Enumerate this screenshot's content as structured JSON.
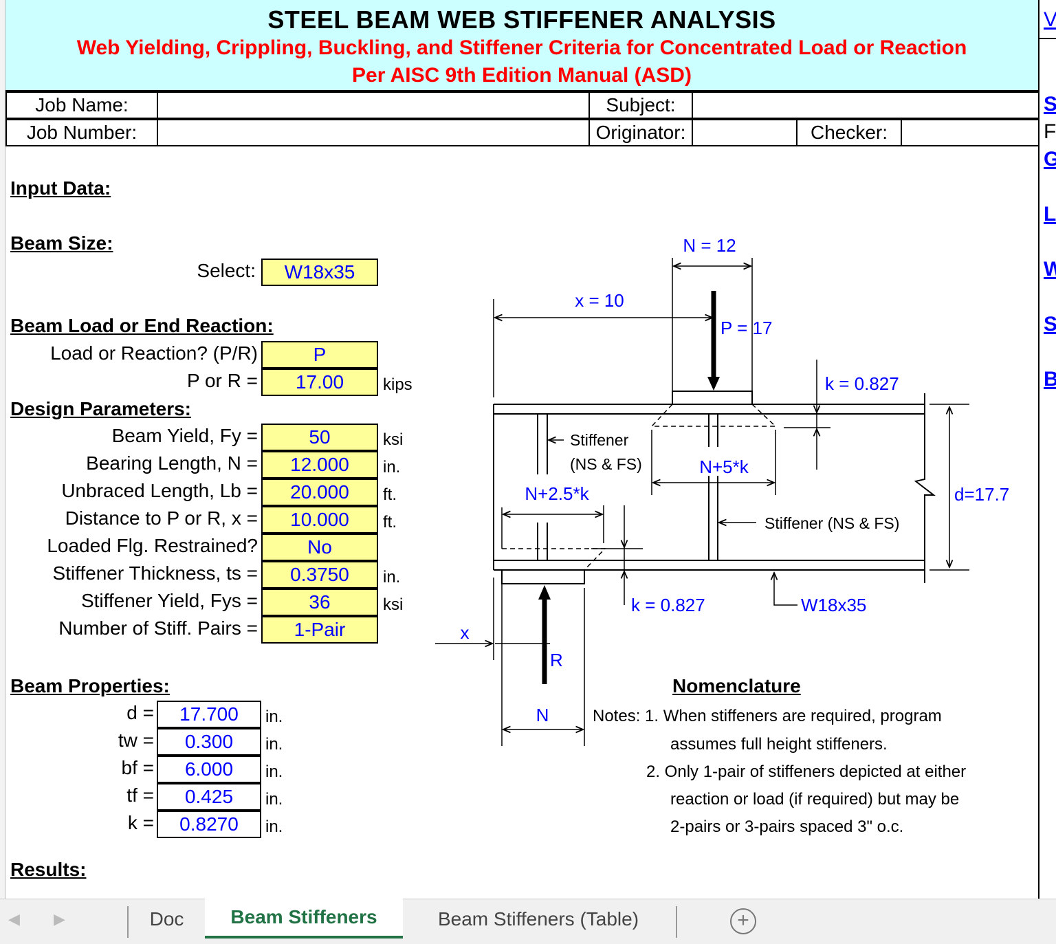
{
  "header": {
    "title": "STEEL BEAM WEB STIFFENER ANALYSIS",
    "subtitle1": "Web Yielding, Crippling, Buckling, and Stiffener Criteria for Concentrated Load or Reaction",
    "subtitle2": "Per AISC 9th Edition Manual (ASD)"
  },
  "job": {
    "job_name_label": "Job Name:",
    "job_number_label": "Job Number:",
    "subject_label": "Subject:",
    "originator_label": "Originator:",
    "checker_label": "Checker:",
    "job_name": "",
    "job_number": "",
    "subject": "",
    "originator": "",
    "checker": ""
  },
  "right_links": [
    "V",
    "S",
    "F",
    "G",
    "L",
    "W",
    "S",
    "B"
  ],
  "input_heading": "Input Data:",
  "beam_size": {
    "heading": "Beam Size:",
    "select_label": "Select:",
    "select_value": "W18x35"
  },
  "load": {
    "heading": "Beam Load or End Reaction:",
    "rows": [
      {
        "label": "Load or Reaction? (P/R)",
        "value": "P",
        "unit": ""
      },
      {
        "label": "P or R =",
        "value": "17.00",
        "unit": "kips"
      }
    ]
  },
  "design": {
    "heading": "Design Parameters:",
    "rows": [
      {
        "label": "Beam Yield, Fy =",
        "value": "50",
        "unit": "ksi"
      },
      {
        "label": "Bearing Length, N =",
        "value": "12.000",
        "unit": "in."
      },
      {
        "label": "Unbraced Length, Lb =",
        "value": "20.000",
        "unit": "ft."
      },
      {
        "label": "Distance to P or R, x =",
        "value": "10.000",
        "unit": "ft."
      },
      {
        "label": "Loaded Flg. Restrained?",
        "value": "No",
        "unit": ""
      },
      {
        "label": "Stiffener Thickness, ts =",
        "value": "0.3750",
        "unit": "in."
      },
      {
        "label": "Stiffener Yield, Fys =",
        "value": "36",
        "unit": "ksi"
      },
      {
        "label": "Number of Stiff. Pairs =",
        "value": "1-Pair",
        "unit": ""
      }
    ]
  },
  "props": {
    "heading": "Beam Properties:",
    "rows": [
      {
        "label": "d =",
        "value": "17.700",
        "unit": "in."
      },
      {
        "label": "tw =",
        "value": "0.300",
        "unit": "in."
      },
      {
        "label": "bf =",
        "value": "6.000",
        "unit": "in."
      },
      {
        "label": "tf =",
        "value": "0.425",
        "unit": "in."
      },
      {
        "label": "k =",
        "value": "0.8270",
        "unit": "in."
      }
    ]
  },
  "results_heading": "Results:",
  "diagram": {
    "n_top": "N = 12",
    "x_top": "x = 10",
    "p": "P = 17",
    "k_top": "k = 0.827",
    "stiff_left_1": "Stiffener",
    "stiff_left_2": "(NS & FS)",
    "n5k": "N+5*k",
    "n25k": "N+2.5*k",
    "stiff_right": "Stiffener (NS & FS)",
    "d": "d=17.7",
    "k_bot": "k = 0.827",
    "section": "W18x35",
    "x_bot": "x",
    "r": "R",
    "n_bot": "N"
  },
  "nomenclature": {
    "heading": "Nomenclature",
    "lines": [
      "Notes: 1. When stiffeners are required, program",
      "assumes full height stiffeners.",
      "2. Only 1-pair of stiffeners depicted at either",
      "reaction or load (if required) but may be",
      "2-pairs or 3-pairs spaced 3\" o.c."
    ]
  },
  "tabs": {
    "items": [
      "Doc",
      "Beam Stiffeners",
      "Beam Stiffeners (Table)"
    ],
    "active": "Beam Stiffeners"
  },
  "colors": {
    "banner": "#ccffff",
    "input": "#ffff99",
    "title_red": "#ff0000",
    "value_blue": "#0000ff",
    "active_tab": "#217346"
  }
}
